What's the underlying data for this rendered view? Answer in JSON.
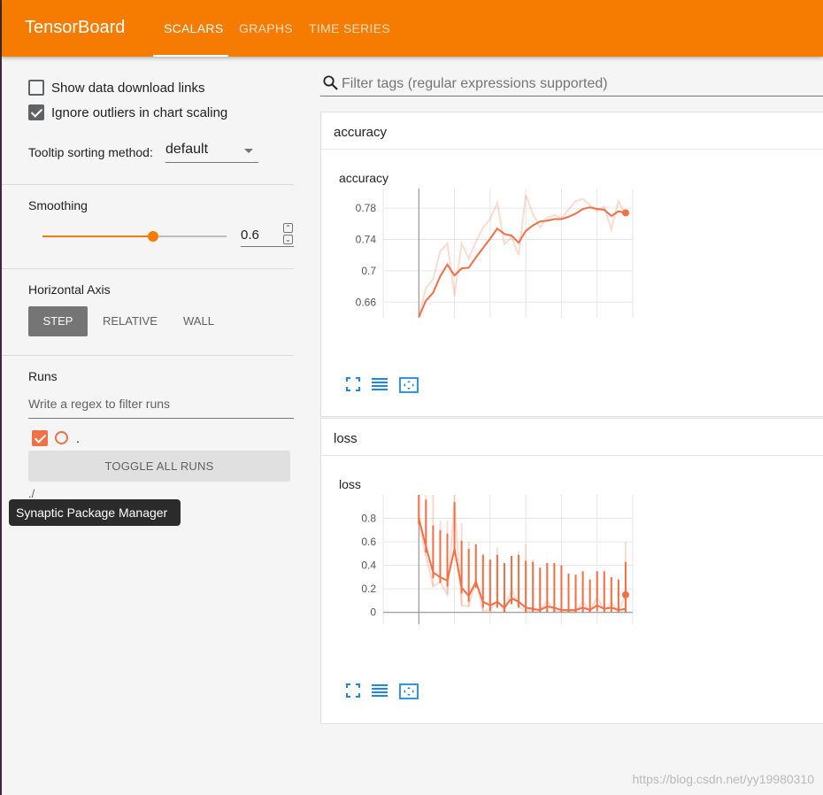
{
  "header": {
    "title": "TensorBoard",
    "tabs": [
      {
        "label": "SCALARS",
        "active": true
      },
      {
        "label": "GRAPHS",
        "active": false
      },
      {
        "label": "TIME SERIES",
        "active": false
      }
    ]
  },
  "sidebar": {
    "show_download_links": {
      "label": "Show data download links",
      "checked": false
    },
    "ignore_outliers": {
      "label": "Ignore outliers in chart scaling",
      "checked": true
    },
    "tooltip_sorting": {
      "label": "Tooltip sorting method:",
      "value": "default"
    },
    "smoothing": {
      "label": "Smoothing",
      "value": "0.6",
      "slider_fraction": 0.6
    },
    "horizontal_axis": {
      "label": "Horizontal Axis",
      "options": [
        {
          "label": "STEP",
          "selected": true
        },
        {
          "label": "RELATIVE",
          "selected": false
        },
        {
          "label": "WALL",
          "selected": false
        }
      ]
    },
    "runs": {
      "label": "Runs",
      "filter_placeholder": "Write a regex to filter runs",
      "items": [
        {
          "name": ".",
          "checked": true
        }
      ],
      "toggle_label": "TOGGLE ALL RUNS",
      "log_dir": "./"
    }
  },
  "tooltip": {
    "text": "Synaptic Package Manager"
  },
  "main": {
    "filter_placeholder": "Filter tags (regular expressions supported)",
    "cards": [
      {
        "title": "accuracy",
        "chart_title": "accuracy"
      },
      {
        "title": "loss",
        "chart_title": "loss"
      }
    ]
  },
  "watermark": "https://blog.csdn.net/yy19980310",
  "colors": {
    "brand": "#f57c00",
    "series": "#f36f45"
  },
  "chart_data": [
    {
      "type": "line",
      "title": "accuracy",
      "x": [
        0,
        1,
        2,
        3,
        4,
        5,
        6,
        7,
        8,
        9,
        10,
        11,
        12,
        13,
        14,
        15,
        16,
        17,
        18,
        19,
        20,
        21,
        22,
        23,
        24,
        25,
        26,
        27,
        28,
        29
      ],
      "x_ticks": [
        0,
        5,
        10,
        15,
        20,
        25
      ],
      "y_ticks": [
        0.66,
        0.7,
        0.74,
        0.78
      ],
      "xlim": [
        -5,
        30
      ],
      "ylim": [
        0.64,
        0.805
      ],
      "series": [
        {
          "role": "smoothed",
          "values": [
            0.641,
            0.662,
            0.672,
            0.693,
            0.708,
            0.694,
            0.703,
            0.704,
            0.717,
            0.729,
            0.741,
            0.754,
            0.747,
            0.745,
            0.736,
            0.751,
            0.758,
            0.763,
            0.764,
            0.766,
            0.766,
            0.769,
            0.773,
            0.779,
            0.781,
            0.779,
            0.778,
            0.77,
            0.776,
            0.774
          ]
        },
        {
          "role": "raw",
          "values": [
            0.641,
            0.678,
            0.689,
            0.725,
            0.735,
            0.668,
            0.735,
            0.716,
            0.737,
            0.755,
            0.766,
            0.787,
            0.734,
            0.743,
            0.72,
            0.797,
            0.773,
            0.755,
            0.768,
            0.771,
            0.767,
            0.778,
            0.789,
            0.792,
            0.784,
            0.776,
            0.782,
            0.753,
            0.789,
            0.771
          ]
        }
      ]
    },
    {
      "type": "line",
      "title": "loss",
      "x": [
        0,
        1,
        2,
        3,
        4,
        5,
        6,
        7,
        8,
        9,
        10,
        11,
        12,
        13,
        14,
        15,
        16,
        17,
        18,
        19,
        20,
        21,
        22,
        23,
        24,
        25,
        26,
        27,
        28,
        29
      ],
      "x_ticks": [
        0,
        5,
        10,
        15,
        20,
        25
      ],
      "y_ticks": [
        0,
        0.2,
        0.4,
        0.6,
        0.8
      ],
      "xlim": [
        -5,
        30
      ],
      "ylim": [
        -0.1,
        1.0
      ],
      "series": [
        {
          "role": "smoothed",
          "values": [
            0.8,
            0.56,
            0.34,
            0.3,
            0.27,
            0.54,
            0.21,
            0.14,
            0.26,
            0.09,
            0.06,
            0.09,
            0.04,
            0.12,
            0.09,
            0.04,
            0.03,
            0.02,
            0.05,
            0.04,
            0.02,
            0.02,
            0.02,
            0.04,
            0.02,
            0.06,
            0.03,
            0.04,
            0.02,
            0.03
          ]
        },
        {
          "role": "raw",
          "values": [
            0.76,
            0.48,
            0.22,
            0.26,
            0.15,
            0.95,
            0.06,
            0.05,
            0.28,
            0.01,
            0.02,
            0.1,
            0.01,
            0.2,
            0.05,
            0.01,
            0.02,
            0.01,
            0.1,
            0.01,
            0.02,
            0.01,
            0.01,
            0.09,
            0.01,
            0.13,
            0.02,
            0.08,
            0.01,
            0.15
          ]
        },
        {
          "role": "range_high",
          "values": [
            1.0,
            1.0,
            1.0,
            0.78,
            0.78,
            1.0,
            0.76,
            0.6,
            0.58,
            0.5,
            0.45,
            0.55,
            0.42,
            0.48,
            0.52,
            0.58,
            0.45,
            0.38,
            0.42,
            0.42,
            0.4,
            0.33,
            0.32,
            0.35,
            0.28,
            0.35,
            0.35,
            0.3,
            0.28,
            0.6
          ]
        }
      ]
    }
  ]
}
